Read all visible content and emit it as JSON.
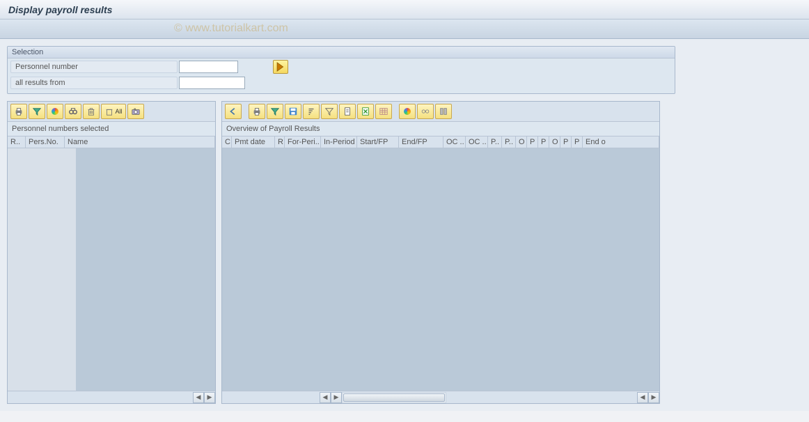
{
  "title": "Display payroll results",
  "watermark": "© www.tutorialkart.com",
  "selection": {
    "panel_title": "Selection",
    "personnel_label": "Personnel number",
    "personnel_value": "",
    "results_label": "all results from",
    "results_value": ""
  },
  "left": {
    "subtitle": "Personnel numbers selected",
    "columns": {
      "c1": "R..",
      "c2": "Pers.No.",
      "c3": "Name"
    },
    "toolbar": {
      "print": "print-icon",
      "filter": "filter-icon",
      "chart": "chart-icon",
      "find": "find-icon",
      "delete": "delete-icon",
      "delete_all": "All",
      "refresh": "refresh-icon"
    }
  },
  "right": {
    "subtitle": "Overview of Payroll Results",
    "columns": {
      "c1": "C",
      "c2": "Pmt date",
      "c3": "R",
      "c4": "For-Peri..",
      "c5": "In-Period",
      "c6": "Start/FP",
      "c7": "End/FP",
      "c8": "OC ..",
      "c9": "OC ..",
      "c10": "P..",
      "c11": "P..",
      "c12": "O",
      "c13": "P",
      "c14": "P",
      "c15": "O",
      "c16": "P",
      "c17": "P",
      "c18": "End o"
    }
  }
}
